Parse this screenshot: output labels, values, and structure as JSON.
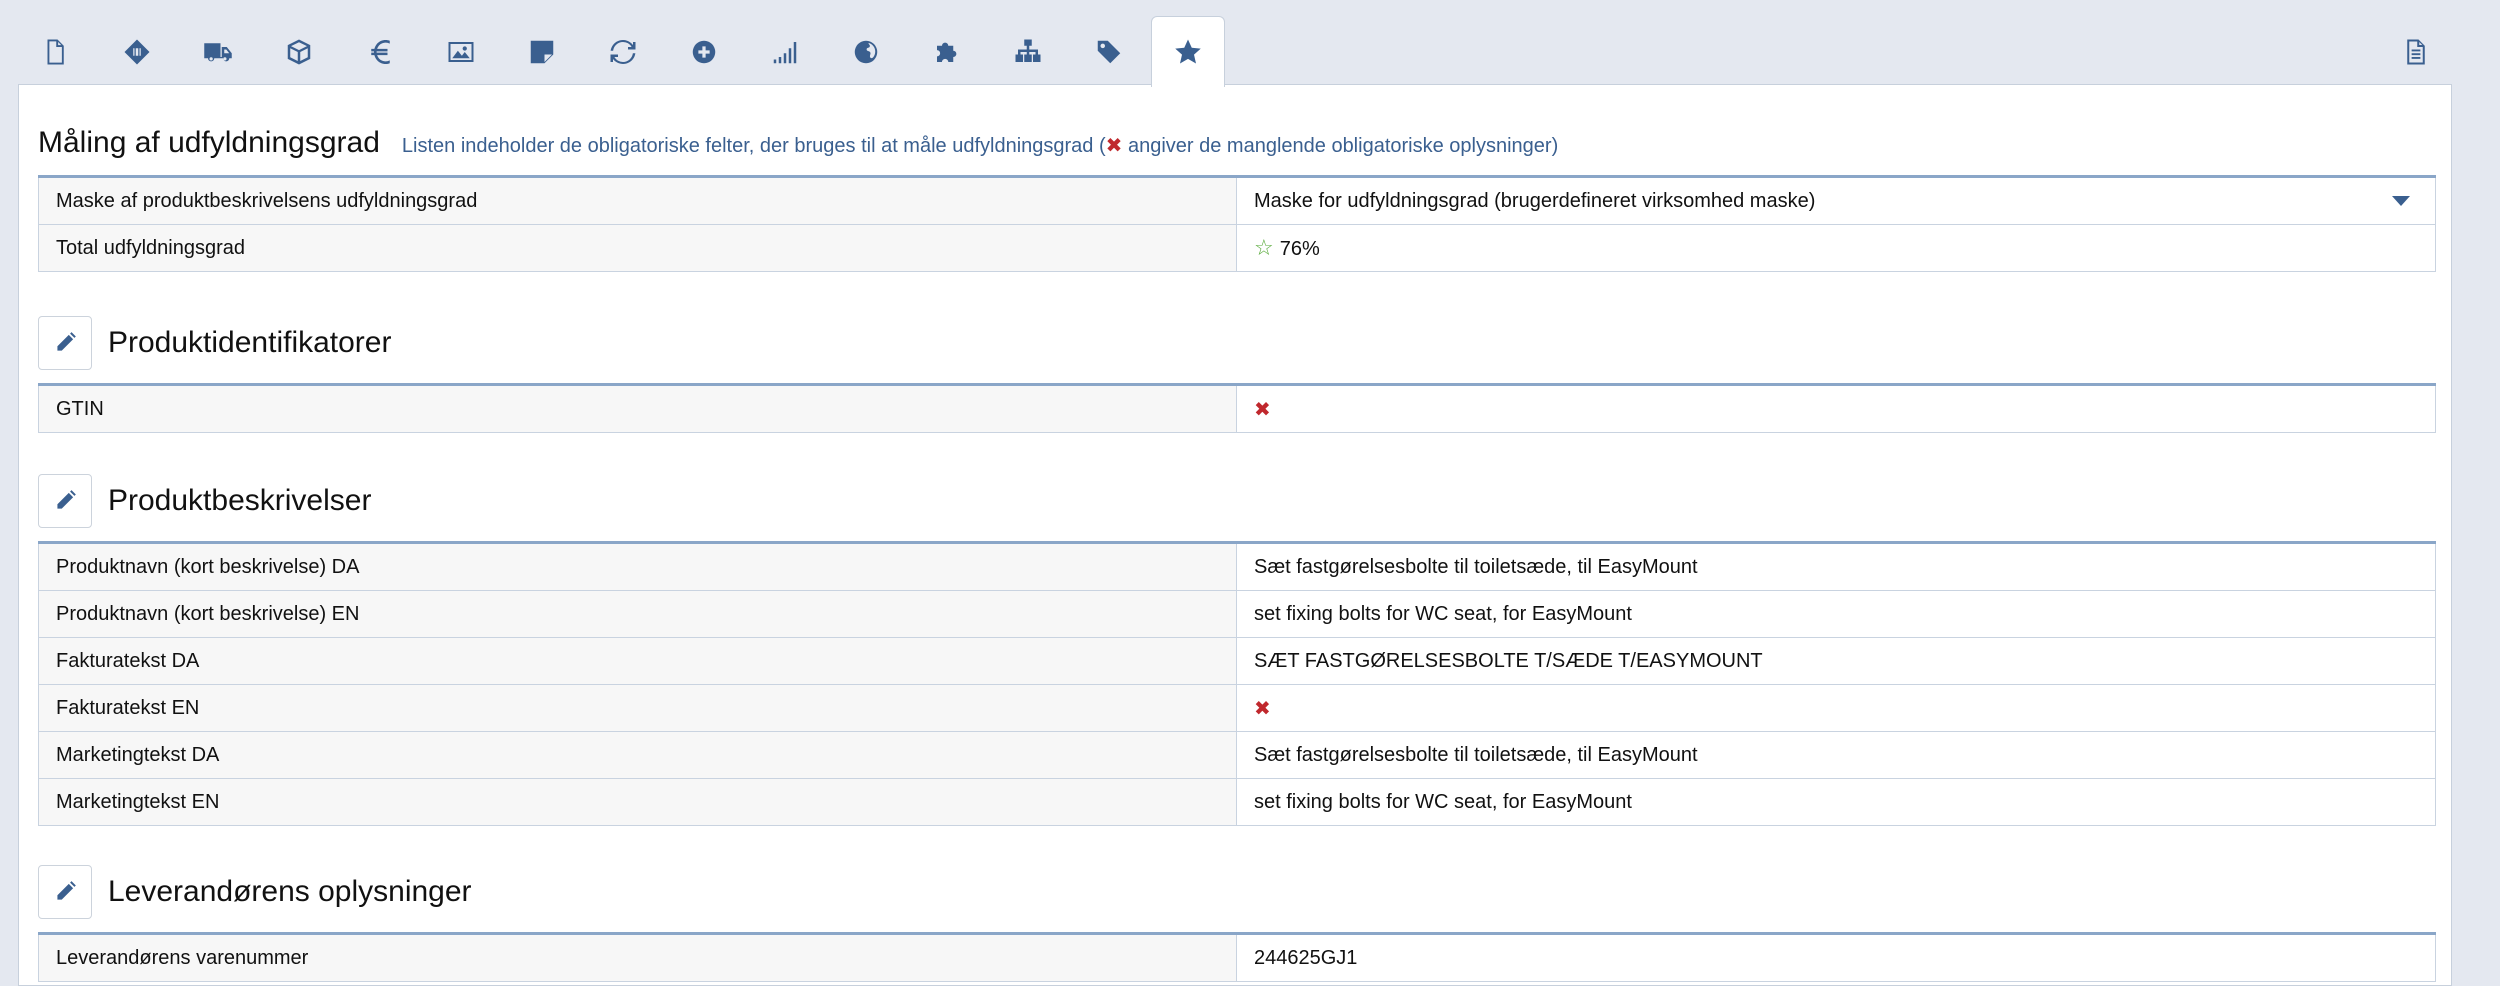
{
  "tabs": [
    {
      "icon": "document-icon"
    },
    {
      "icon": "barcode-tag-icon"
    },
    {
      "icon": "truck-icon"
    },
    {
      "icon": "package-icon"
    },
    {
      "icon": "euro-icon"
    },
    {
      "icon": "image-icon"
    },
    {
      "icon": "note-icon"
    },
    {
      "icon": "refresh-icon"
    },
    {
      "icon": "plus-circle-icon"
    },
    {
      "icon": "signal-icon"
    },
    {
      "icon": "globe-icon"
    },
    {
      "icon": "puzzle-icon"
    },
    {
      "icon": "sitemap-icon"
    },
    {
      "icon": "tag-icon"
    },
    {
      "icon": "star-icon",
      "active": true
    },
    {
      "icon": "list-document-icon"
    }
  ],
  "completeness": {
    "title": "Måling af udfyldningsgrad",
    "subtitle_before": "Listen indeholder de obligatoriske felter, der bruges til at måle udfyldningsgrad (",
    "subtitle_mark": "✖",
    "subtitle_after": " angiver de manglende obligatoriske oplysninger)",
    "rows": [
      {
        "label": "Maske af produktbeskrivelsens udfyldningsgrad",
        "value": "Maske for udfyldningsgrad (brugerdefineret virksomhed maske)"
      },
      {
        "label": "Total udfyldningsgrad",
        "value": "76%"
      }
    ]
  },
  "identifiers": {
    "title": "Produktidentifikatorer",
    "rows": [
      {
        "label": "GTIN",
        "value": "✖"
      }
    ]
  },
  "descriptions": {
    "title": "Produktbeskrivelser",
    "rows": [
      {
        "label": "Produktnavn (kort beskrivelse) DA",
        "value": "Sæt fastgørelsesbolte til toiletsæde, til EasyMount"
      },
      {
        "label": "Produktnavn (kort beskrivelse) EN",
        "value": "set fixing bolts for WC seat, for EasyMount"
      },
      {
        "label": "Fakturatekst DA",
        "value": "SÆT FASTGØRELSESBOLTE T/SÆDE T/EASYMOUNT"
      },
      {
        "label": "Fakturatekst EN",
        "value": "✖"
      },
      {
        "label": "Marketingtekst DA",
        "value": "Sæt fastgørelsesbolte til toiletsæde, til EasyMount"
      },
      {
        "label": "Marketingtekst EN",
        "value": "set fixing bolts for WC seat, for EasyMount"
      }
    ]
  },
  "supplier": {
    "title": "Leverandørens oplysninger",
    "rows": [
      {
        "label": "Leverandørens varenummer",
        "value": "244625GJ1"
      }
    ]
  },
  "colors": {
    "accent": "#3a5f8f",
    "missing": "#c0282d",
    "star": "#5aab3c"
  }
}
